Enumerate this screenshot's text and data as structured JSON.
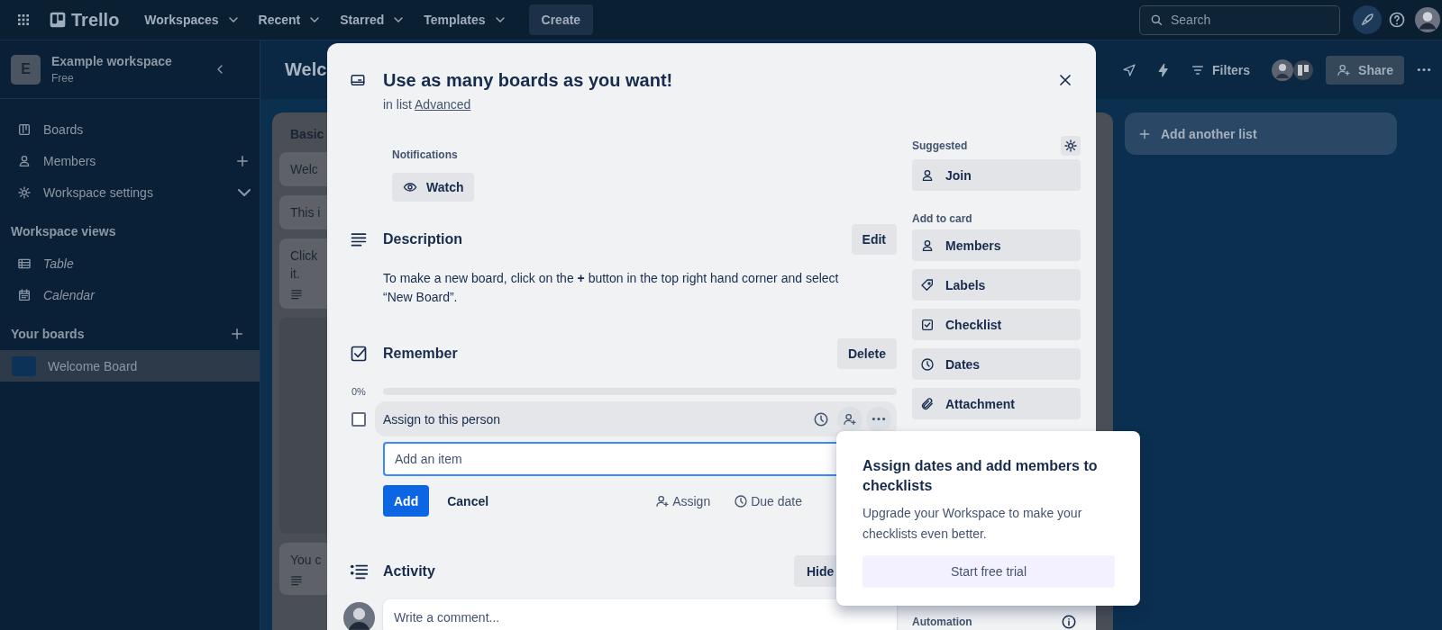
{
  "topbar": {
    "app_name": "Trello",
    "menus": [
      {
        "label": "Workspaces"
      },
      {
        "label": "Recent"
      },
      {
        "label": "Starred"
      },
      {
        "label": "Templates"
      }
    ],
    "create_button": "Create",
    "search": {
      "placeholder": "Search"
    }
  },
  "sidebar": {
    "workspace": {
      "initial": "E",
      "name": "Example workspace",
      "plan": "Free"
    },
    "nav": [
      {
        "label": "Boards",
        "selected": false
      },
      {
        "label": "Members",
        "selected": false
      },
      {
        "label": "Workspace settings",
        "selected": false
      }
    ],
    "views_heading": "Workspace views",
    "views": [
      {
        "label": "Table",
        "selected": false
      },
      {
        "label": "Calendar",
        "selected": false
      }
    ],
    "boards_heading": "Your boards",
    "boards": [
      {
        "label": "Welcome Board",
        "selected": true
      }
    ]
  },
  "board": {
    "title": "Welc",
    "filters_button": "Filters",
    "share_button": "Share",
    "lists": [
      {
        "title": "Basic",
        "cards": [
          {
            "kind": "text",
            "lines": [
              "Welc"
            ],
            "has_description": false
          },
          {
            "kind": "text",
            "lines": [
              "This i"
            ],
            "has_description": false
          },
          {
            "kind": "text",
            "lines": [
              "Click",
              "it."
            ],
            "has_description": true
          },
          {
            "kind": "cover"
          },
          {
            "kind": "text",
            "lines": [
              "You c"
            ],
            "has_description": true
          }
        ]
      }
    ],
    "add_list": "Add another list"
  },
  "card_modal": {
    "title": "Use as many boards as you want!",
    "list_prefix": "in list",
    "list_name": "Advanced",
    "notifications": {
      "label": "Notifications",
      "button": "Watch"
    },
    "description": {
      "heading": "Description",
      "edit_button": "Edit",
      "text": "To make a new board, click on the **+** button in the top right hand corner and select “New Board”."
    },
    "checklist": {
      "title": "Remember",
      "delete_button": "Delete",
      "percent": "0%",
      "level": 0,
      "items": [
        {
          "text": "Assign to this person",
          "checked": false
        }
      ],
      "new_item": {
        "placeholder": "Add an item"
      },
      "add_button": "Add",
      "cancel_button": "Cancel",
      "actions": [
        "Assign",
        "Due date"
      ]
    },
    "activity": {
      "heading": "Activity",
      "hide_button": "Hide",
      "comment_placeholder": "Write a comment..."
    },
    "side": {
      "suggested": "Suggested",
      "suggested_buttons": [
        "Join"
      ],
      "add_heading": "Add to card",
      "add_buttons": [
        "Members",
        "Labels",
        "Checklist",
        "Dates",
        "Attachment"
      ],
      "automation": "Automation"
    }
  },
  "popover": {
    "title": "Assign dates and add members to checklists",
    "text": "Upgrade your Workspace to make your checklists even better.",
    "button": "Start free trial"
  }
}
